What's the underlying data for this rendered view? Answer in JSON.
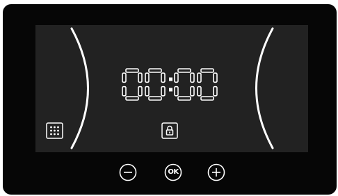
{
  "display": {
    "time": "00:00",
    "accent_color": "#ffffff",
    "screen_color": "#222222",
    "panel_color": "#060606",
    "icons": {
      "grid": "grid-icon",
      "lock": "lock-icon"
    }
  },
  "controls": {
    "minus_icon": "minus-icon",
    "ok_label": "OK",
    "plus_icon": "plus-icon"
  }
}
